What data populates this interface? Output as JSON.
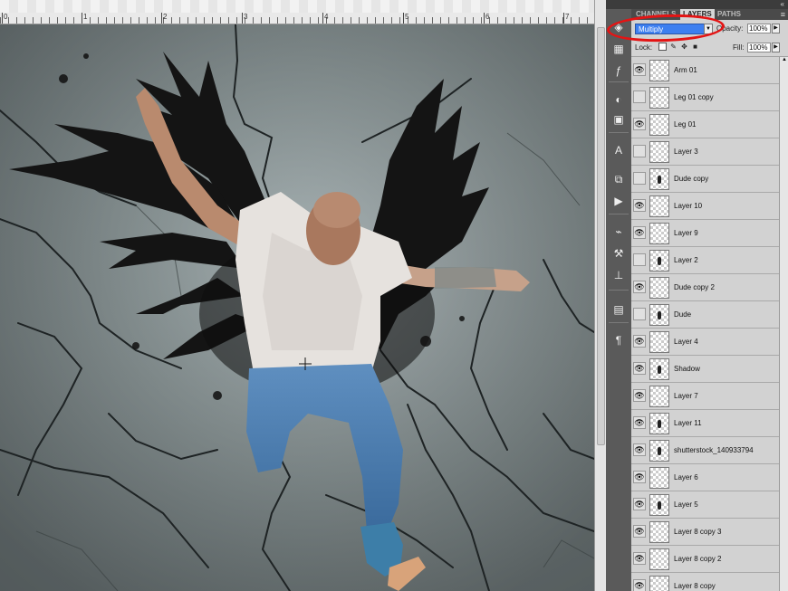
{
  "ruler": {
    "labels": [
      "0",
      "1",
      "2",
      "3",
      "4",
      "5",
      "6",
      "7"
    ]
  },
  "panel": {
    "tabs": [
      {
        "label": "CHANNELS",
        "active": false
      },
      {
        "label": "LAYERS",
        "active": true
      },
      {
        "label": "PATHS",
        "active": false
      }
    ],
    "blend_mode": "Multiply",
    "opacity_label": "Opacity:",
    "opacity_value": "100%",
    "lock_label": "Lock:",
    "fill_label": "Fill:",
    "fill_value": "100%"
  },
  "layers": [
    {
      "name": "Arm 01",
      "visible": true
    },
    {
      "name": "Leg 01 copy",
      "visible": false
    },
    {
      "name": "Leg 01",
      "visible": true
    },
    {
      "name": "Layer 3",
      "visible": false
    },
    {
      "name": "Dude copy",
      "visible": false
    },
    {
      "name": "Layer 10",
      "visible": true
    },
    {
      "name": "Layer 9",
      "visible": true
    },
    {
      "name": "Layer 2",
      "visible": false
    },
    {
      "name": "Dude copy 2",
      "visible": true
    },
    {
      "name": "Dude",
      "visible": false
    },
    {
      "name": "Layer 4",
      "visible": true
    },
    {
      "name": "Shadow",
      "visible": true
    },
    {
      "name": "Layer 7",
      "visible": true
    },
    {
      "name": "Layer 11",
      "visible": true
    },
    {
      "name": "shutterstock_140933794",
      "visible": true
    },
    {
      "name": "Layer 6",
      "visible": true
    },
    {
      "name": "Layer 5",
      "visible": true
    },
    {
      "name": "Layer 8 copy 3",
      "visible": true
    },
    {
      "name": "Layer 8 copy 2",
      "visible": true
    },
    {
      "name": "Layer 8 copy",
      "visible": true
    }
  ],
  "tools": [
    "layer-comps-icon",
    "histogram-icon",
    "fx-icon",
    "color-icon",
    "swatch-icon",
    "character-icon",
    "clone-source-icon",
    "actions-icon",
    "brush-preset-icon",
    "tool-preset-icon",
    "stamp-icon",
    "navigator-icon",
    "paragraph-icon"
  ]
}
